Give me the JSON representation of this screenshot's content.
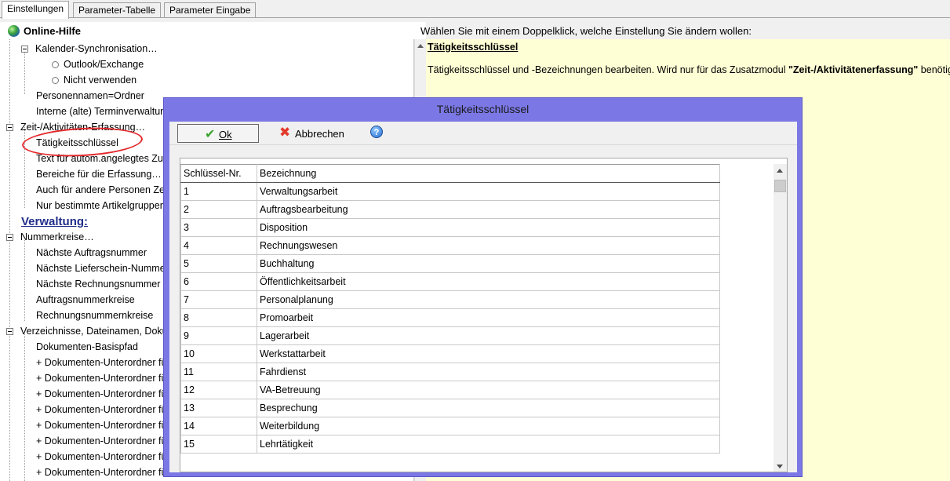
{
  "tabs": [
    {
      "label": "Einstellungen",
      "active": true
    },
    {
      "label": "Parameter-Tabelle",
      "active": false
    },
    {
      "label": "Parameter Eingabe",
      "active": false
    }
  ],
  "header": {
    "help_title": "Online-Hilfe",
    "instruction": "Wählen Sie mit einem Doppelklick, welche Einstellung Sie ändern wollen:"
  },
  "tree": {
    "items": [
      {
        "label": "Kalender-Synchronisation…"
      },
      {
        "label": "Outlook/Exchange"
      },
      {
        "label": "Nicht verwenden"
      },
      {
        "label": "Personennamen=Ordner"
      },
      {
        "label": "Interne (alte) Terminverwaltung"
      },
      {
        "label": "Zeit-/Aktivitäten-Erfassung…"
      },
      {
        "label": "Tätigkeitsschlüssel"
      },
      {
        "label": "Text für autom.angelegtes Zusatz…"
      },
      {
        "label": "Bereiche für die Erfassung…"
      },
      {
        "label": "Auch für andere Personen Zeiten…"
      },
      {
        "label": "Nur bestimmte Artikelgruppen…"
      },
      {
        "label": "Verwaltung:"
      },
      {
        "label": "Nummerkreise…"
      },
      {
        "label": "Nächste Auftragsnummer"
      },
      {
        "label": "Nächste Lieferschein-Nummer"
      },
      {
        "label": "Nächste Rechnungsnummer"
      },
      {
        "label": "Auftragsnummerkreise"
      },
      {
        "label": "Rechnungsnummernkreise"
      },
      {
        "label": "Verzeichnisse, Dateinamen, Dokumente…"
      },
      {
        "label": "Dokumenten-Basispfad"
      },
      {
        "label": "+ Dokumenten-Unterordner für…"
      },
      {
        "label": "+ Dokumenten-Unterordner für…"
      },
      {
        "label": "+ Dokumenten-Unterordner für…"
      },
      {
        "label": "+ Dokumenten-Unterordner für…"
      },
      {
        "label": "+ Dokumenten-Unterordner für…"
      },
      {
        "label": "+ Dokumenten-Unterordner für…"
      },
      {
        "label": "+ Dokumenten-Unterordner für…"
      },
      {
        "label": "+ Dokumenten-Unterordner für…"
      }
    ]
  },
  "help": {
    "heading": "Tätigkeitsschlüssel",
    "text_before": "Tätigkeitsschlüssel und -Bezeichnungen bearbeiten. Wird nur für das Zusatzmodul ",
    "text_bold": "\"Zeit-/Aktivitätenerfassung\"",
    "text_after": " benötigt."
  },
  "dialog": {
    "title": "Tätigkeitsschlüssel",
    "ok_label": "Ok",
    "cancel_label": "Abbrechen",
    "help_glyph": "?",
    "columns": [
      "Schlüssel-Nr.",
      "Bezeichnung"
    ],
    "rows": [
      [
        "1",
        "Verwaltungsarbeit"
      ],
      [
        "2",
        "Auftragsbearbeitung"
      ],
      [
        "3",
        "Disposition"
      ],
      [
        "4",
        "Rechnungswesen"
      ],
      [
        "5",
        "Buchhaltung"
      ],
      [
        "6",
        "Öffentlichkeitsarbeit"
      ],
      [
        "7",
        "Personalplanung"
      ],
      [
        "8",
        "Promoarbeit"
      ],
      [
        "9",
        "Lagerarbeit"
      ],
      [
        "10",
        "Werkstattarbeit"
      ],
      [
        "11",
        "Fahrdienst"
      ],
      [
        "12",
        "VA-Betreuung"
      ],
      [
        "13",
        "Besprechung"
      ],
      [
        "14",
        "Weiterbildung"
      ],
      [
        "15",
        "Lehrtätigkeit"
      ]
    ]
  }
}
